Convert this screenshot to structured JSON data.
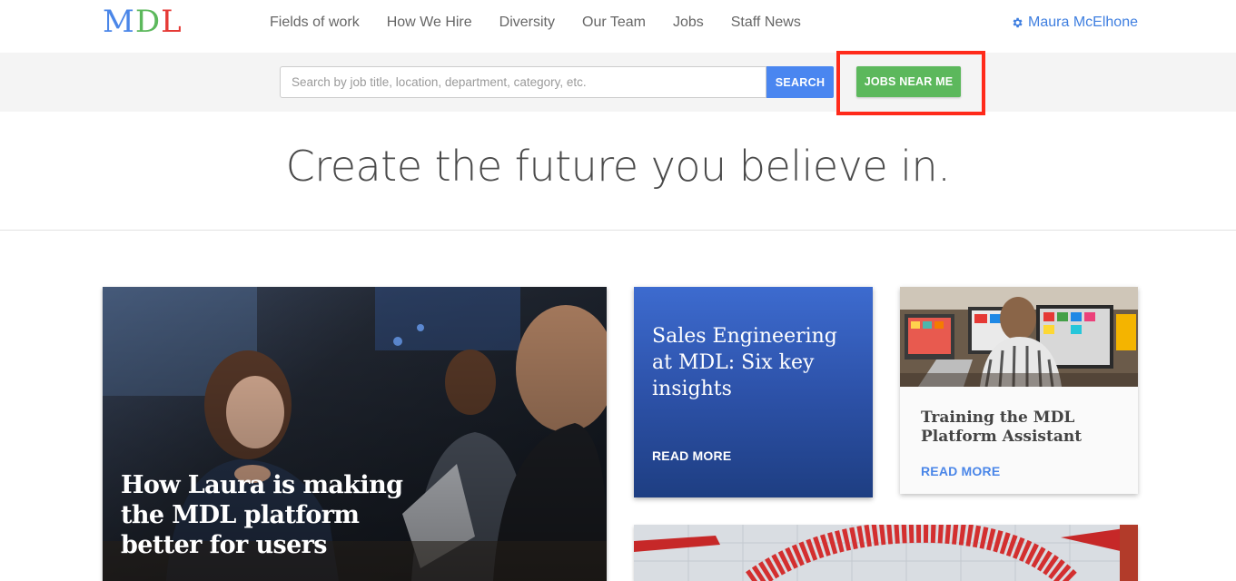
{
  "header": {
    "logo": {
      "m": "M",
      "d": "D",
      "l": "L"
    },
    "nav": [
      {
        "label": "Fields of work"
      },
      {
        "label": "How We Hire"
      },
      {
        "label": "Diversity"
      },
      {
        "label": "Our Team"
      },
      {
        "label": "Jobs"
      },
      {
        "label": "Staff News"
      }
    ],
    "user_name": "Maura McElhone"
  },
  "search": {
    "placeholder": "Search by job title, location, department, category, etc.",
    "value": "",
    "search_label": "SEARCH",
    "near_me_label": "JOBS NEAR ME"
  },
  "hero": {
    "tagline": "Create the future you believe in."
  },
  "cards": {
    "featured": {
      "title": "How Laura is making the MDL platform better for users"
    },
    "sales": {
      "title": "Sales Engineering at MDL: Six key insights",
      "cta": "READ MORE"
    },
    "training": {
      "title": "Training the MDL Platform Assistant",
      "cta": "READ MORE"
    }
  },
  "colors": {
    "logo_m": "#4a86e8",
    "logo_d": "#5cb85c",
    "logo_l": "#e53935",
    "link_blue": "#3f7fe0",
    "search_button": "#4a86f0",
    "near_me_button": "#5cb85c",
    "highlight": "#ff2a1a"
  }
}
